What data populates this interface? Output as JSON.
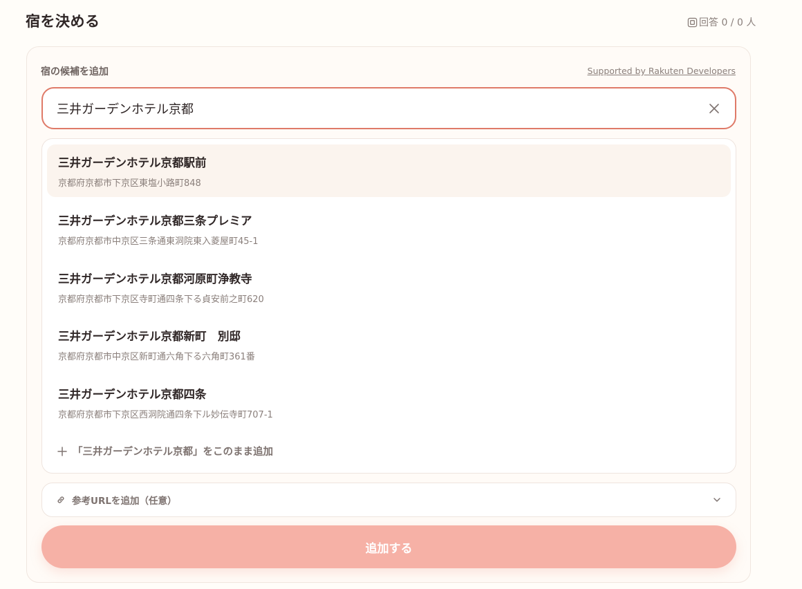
{
  "header": {
    "title": "宿を決める",
    "answer_count": "回答 0 / 0 人"
  },
  "add_candidate": {
    "label": "宿の候補を追加",
    "supported_by": "Supported by Rakuten Developers",
    "search_value": "三井ガーデンホテル京都",
    "results": [
      {
        "name": "三井ガーデンホテル京都駅前",
        "address": "京都府京都市下京区東塩小路町848"
      },
      {
        "name": "三井ガーデンホテル京都三条プレミア",
        "address": "京都府京都市中京区三条通東洞院東入菱屋町45-1"
      },
      {
        "name": "三井ガーデンホテル京都河原町浄教寺",
        "address": "京都府京都市下京区寺町通四条下る貞安前之町620"
      },
      {
        "name": "三井ガーデンホテル京都新町　別邸",
        "address": "京都府京都市中京区新町通六角下る六角町361番"
      },
      {
        "name": "三井ガーデンホテル京都四条",
        "address": "京都府京都市下京区西洞院通四条下ル妙伝寺町707-1"
      }
    ],
    "add_as_is": "「三井ガーデンホテル京都」をこのまま追加",
    "url_label": "参考URLを追加（任意）",
    "submit_label": "追加する"
  },
  "icons": {
    "answer": "answer-icon",
    "clear": "close-icon",
    "plus": "plus-icon",
    "link": "link-icon",
    "chevron": "chevron-down-icon"
  },
  "colors": {
    "accent": "#df7a68",
    "submit_bg": "#f6b1a6",
    "highlight_bg": "#fbf4ee"
  }
}
